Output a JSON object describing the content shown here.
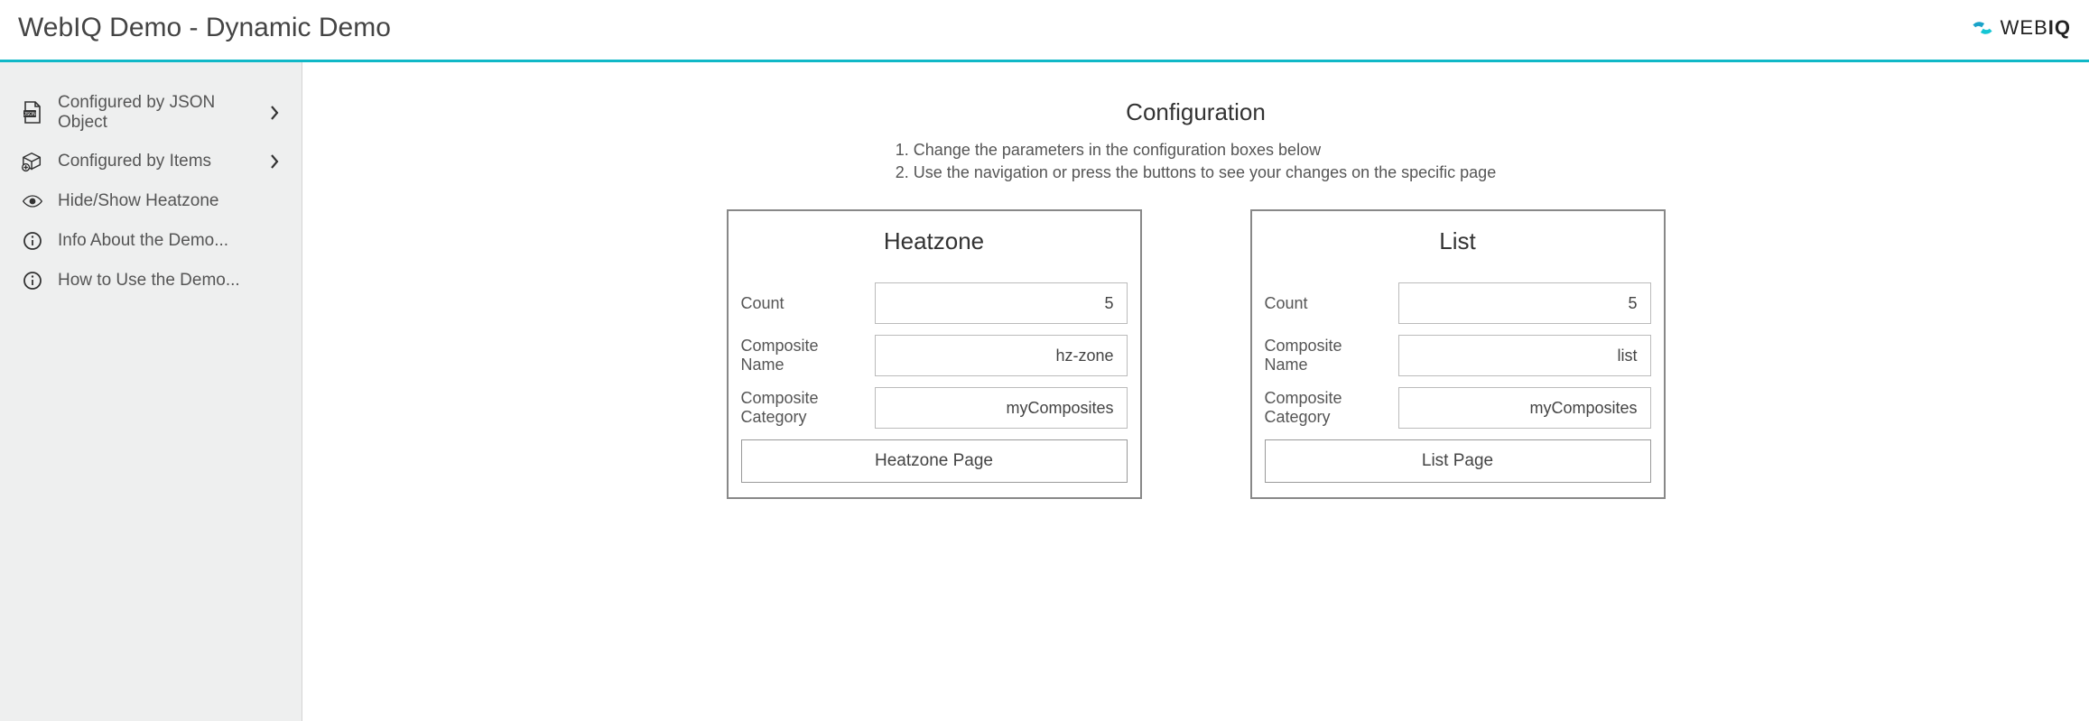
{
  "header": {
    "title": "WebIQ Demo - Dynamic Demo",
    "brand_prefix": "WEB",
    "brand_suffix": "IQ"
  },
  "sidebar": {
    "items": [
      {
        "label": "Configured by JSON Object",
        "icon": "json-file-icon",
        "has_chevron": true
      },
      {
        "label": "Configured by Items",
        "icon": "box-plus-icon",
        "has_chevron": true
      },
      {
        "label": "Hide/Show Heatzone",
        "icon": "eye-icon",
        "has_chevron": false
      },
      {
        "label": "Info About the Demo...",
        "icon": "info-icon",
        "has_chevron": false
      },
      {
        "label": "How to Use the Demo...",
        "icon": "info-icon",
        "has_chevron": false
      }
    ]
  },
  "config": {
    "title": "Configuration",
    "steps": [
      "1. Change the parameters in the configuration boxes below",
      "2. Use the navigation or press the buttons to see your changes on the specific page"
    ]
  },
  "cards": {
    "heatzone": {
      "title": "Heatzone",
      "count_label": "Count",
      "count_value": "5",
      "composite_name_label": "Composite Name",
      "composite_name_value": "hz-zone",
      "composite_category_label": "Composite Category",
      "composite_category_value": "myComposites",
      "button_label": "Heatzone Page"
    },
    "list": {
      "title": "List",
      "count_label": "Count",
      "count_value": "5",
      "composite_name_label": "Composite Name",
      "composite_name_value": "list",
      "composite_category_label": "Composite Category",
      "composite_category_value": "myComposites",
      "button_label": "List Page"
    }
  }
}
